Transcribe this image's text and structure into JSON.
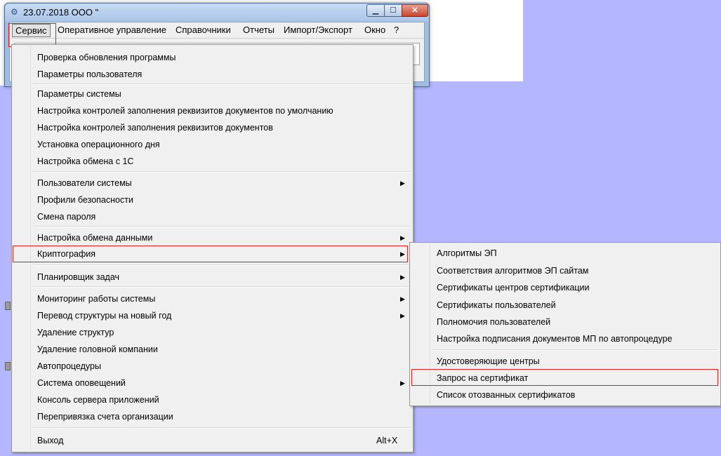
{
  "window": {
    "title": "23.07.2018 ООО \"",
    "controls": {
      "minimize": "▁",
      "maximize": "☐",
      "close": "✕"
    }
  },
  "menubar": {
    "items": [
      "Сервис",
      "Оперативное управление",
      "Справочники",
      "Отчеты",
      "Импорт/Экспорт",
      "Окно",
      "?"
    ]
  },
  "service_menu": {
    "items": [
      "Проверка обновления программы",
      "Параметры пользователя",
      "Параметры системы",
      "Настройка контролей заполнения реквизитов документов по умолчанию",
      "Настройка контролей заполнения реквизитов документов",
      "Установка операционного дня",
      "Настройка обмена с 1С",
      "Пользователи системы",
      "Профили безопасности",
      "Смена пароля",
      "Настройка обмена данными",
      "Криптография",
      "Планировщик задач",
      "Мониторинг работы системы",
      "Перевод структуры на новый год",
      "Удаление структур",
      "Удаление головной компании",
      "Автопроцедуры",
      "Система оповещений",
      "Консоль сервера приложений",
      "Перепривязка счета организации",
      "Выход"
    ],
    "exit_shortcut": "Alt+X",
    "submenu_arrow": "▶"
  },
  "crypto_submenu": {
    "items": [
      "Алгоритмы ЭП",
      "Соответствия алгоритмов ЭП сайтам",
      "Сертификаты центров сертификации",
      "Сертификаты пользователей",
      "Полномочия пользователей",
      "Настройка подписания документов МП по автопроцедуре",
      "Удостоверяющие центры",
      "Запрос на сертификат",
      "Список отозванных сертификатов"
    ]
  },
  "colors": {
    "desktop": "#b4b7ff",
    "highlight_box": "#e02020"
  }
}
